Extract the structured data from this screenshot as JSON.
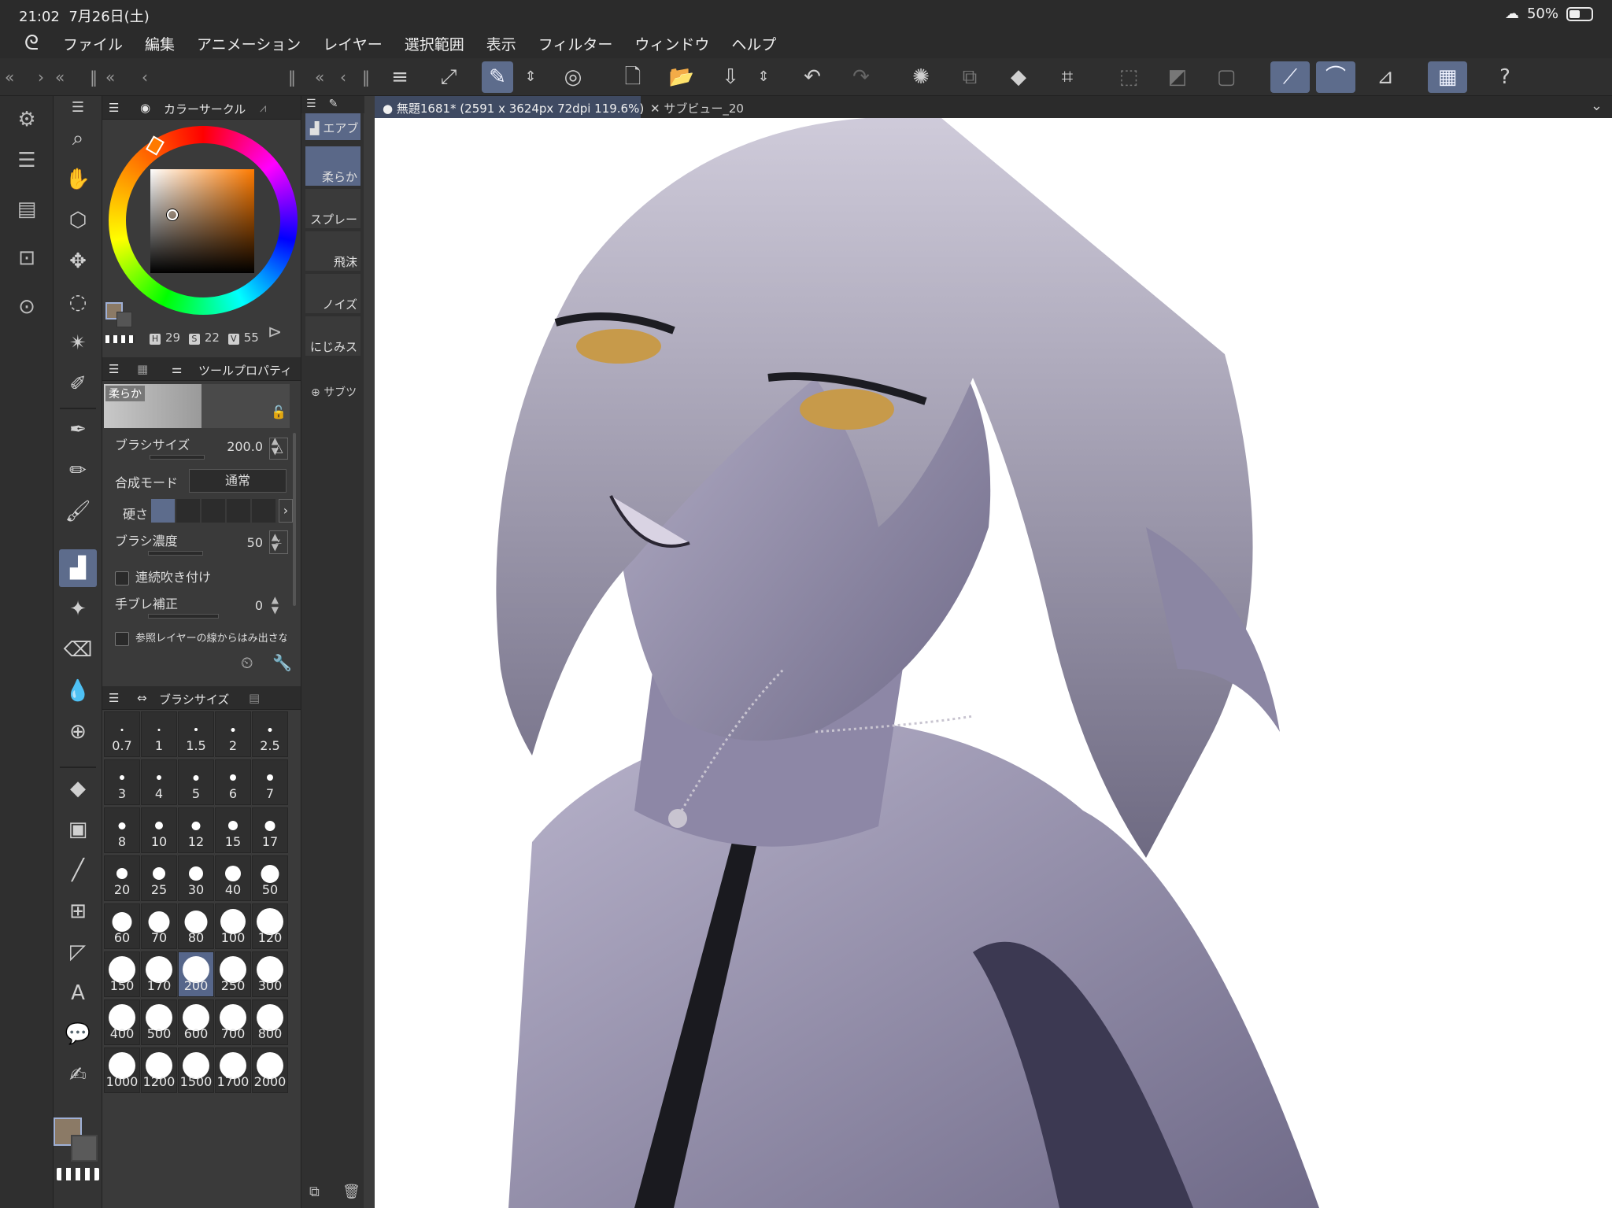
{
  "status": {
    "time": "21:02",
    "date": "7月26日(土)",
    "battery": "50%"
  },
  "menu": [
    "ファイル",
    "編集",
    "アニメーション",
    "レイヤー",
    "選択範囲",
    "表示",
    "フィルター",
    "ウィンドウ",
    "ヘルプ"
  ],
  "color_panel": {
    "title": "カラーサークル",
    "h_label": "H",
    "h": "29",
    "s_label": "S",
    "s": "22",
    "v_label": "V",
    "v": "55",
    "main_color": "#8b7a66"
  },
  "tool_property": {
    "title": "ツールプロパティ",
    "preset_name": "柔らか",
    "brush_size_label": "ブラシサイズ",
    "brush_size": "200.0",
    "blend_label": "合成モード",
    "blend": "通常",
    "hardness_label": "硬さ",
    "density_label": "ブラシ濃度",
    "density": "50",
    "continuous_label": "連続吹き付け",
    "stabilizer_label": "手ブレ補正",
    "stabilizer": "0",
    "ref_layer_label": "参照レイヤーの線からはみ出さない"
  },
  "brush_size_panel": {
    "title": "ブラシサイズ",
    "sizes": [
      "0.7",
      "1",
      "1.5",
      "2",
      "2.5",
      "3",
      "4",
      "5",
      "6",
      "7",
      "8",
      "10",
      "12",
      "15",
      "17",
      "20",
      "25",
      "30",
      "40",
      "50",
      "60",
      "70",
      "80",
      "100",
      "120",
      "150",
      "170",
      "200",
      "250",
      "300",
      "400",
      "500",
      "600",
      "700",
      "800",
      "1000",
      "1200",
      "1500",
      "1700",
      "2000"
    ],
    "selected": "200"
  },
  "sub_tools": {
    "group": "エアブ",
    "items": [
      "柔らか",
      "スプレー",
      "飛沫",
      "ノイズ",
      "にじみス"
    ],
    "add_label": "サブツ"
  },
  "doc_tabs": [
    {
      "label": "無題1681* (2591 x 3624px 72dpi 119.6%)"
    },
    {
      "label": "サブビュー_20"
    }
  ],
  "colors": {
    "accent": "#5d6c8c",
    "panel": "#3a3a3a",
    "bar": "#2b2b2b"
  }
}
